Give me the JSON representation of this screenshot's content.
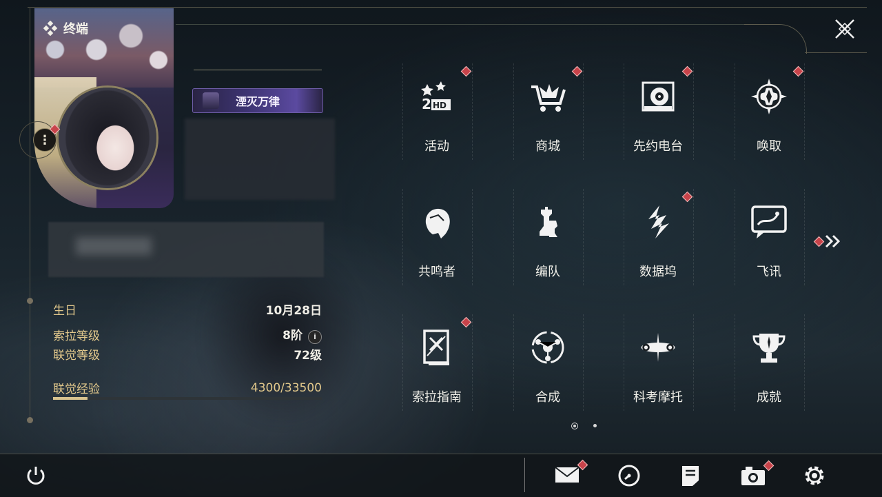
{
  "header": {
    "title": "终端"
  },
  "profile": {
    "title_badge": "湮灭万律",
    "info": [
      {
        "key": "生日",
        "value": "10月28日"
      },
      {
        "key": "索拉等级",
        "value": "8阶"
      },
      {
        "key": "联觉等级",
        "value": "72级"
      },
      {
        "key": "联觉经验",
        "value": "4300/33500"
      }
    ],
    "experience": {
      "current": 4300,
      "max": 33500
    }
  },
  "menu": {
    "items": [
      {
        "label": "活动",
        "icon": "activity-icon",
        "badge": true
      },
      {
        "label": "商城",
        "icon": "shop-cart-icon",
        "badge": true
      },
      {
        "label": "先约电台",
        "icon": "radio-icon",
        "badge": true
      },
      {
        "label": "唤取",
        "icon": "compass-star-icon",
        "badge": true
      },
      {
        "label": "共鸣者",
        "icon": "resonator-head-icon",
        "badge": false
      },
      {
        "label": "编队",
        "icon": "chess-team-icon",
        "badge": false
      },
      {
        "label": "数据坞",
        "icon": "data-dock-icon",
        "badge": true
      },
      {
        "label": "飞讯",
        "icon": "message-icon",
        "badge": false
      },
      {
        "label": "索拉指南",
        "icon": "guidebook-icon",
        "badge": true
      },
      {
        "label": "合成",
        "icon": "synthesis-icon",
        "badge": false
      },
      {
        "label": "科考摩托",
        "icon": "motorbike-icon",
        "badge": false
      },
      {
        "label": "成就",
        "icon": "trophy-icon",
        "badge": false
      }
    ],
    "pages": {
      "current": 1,
      "total": 2
    }
  },
  "bottom_bar": {
    "buttons": [
      "power-icon",
      "mail-icon",
      "clock-icon",
      "notes-icon",
      "camera-icon",
      "settings-gear-icon"
    ]
  },
  "colors": {
    "accent_gold": "#e3c98c",
    "badge_red": "#c8434a",
    "title_purple": "#5b4aa0"
  }
}
